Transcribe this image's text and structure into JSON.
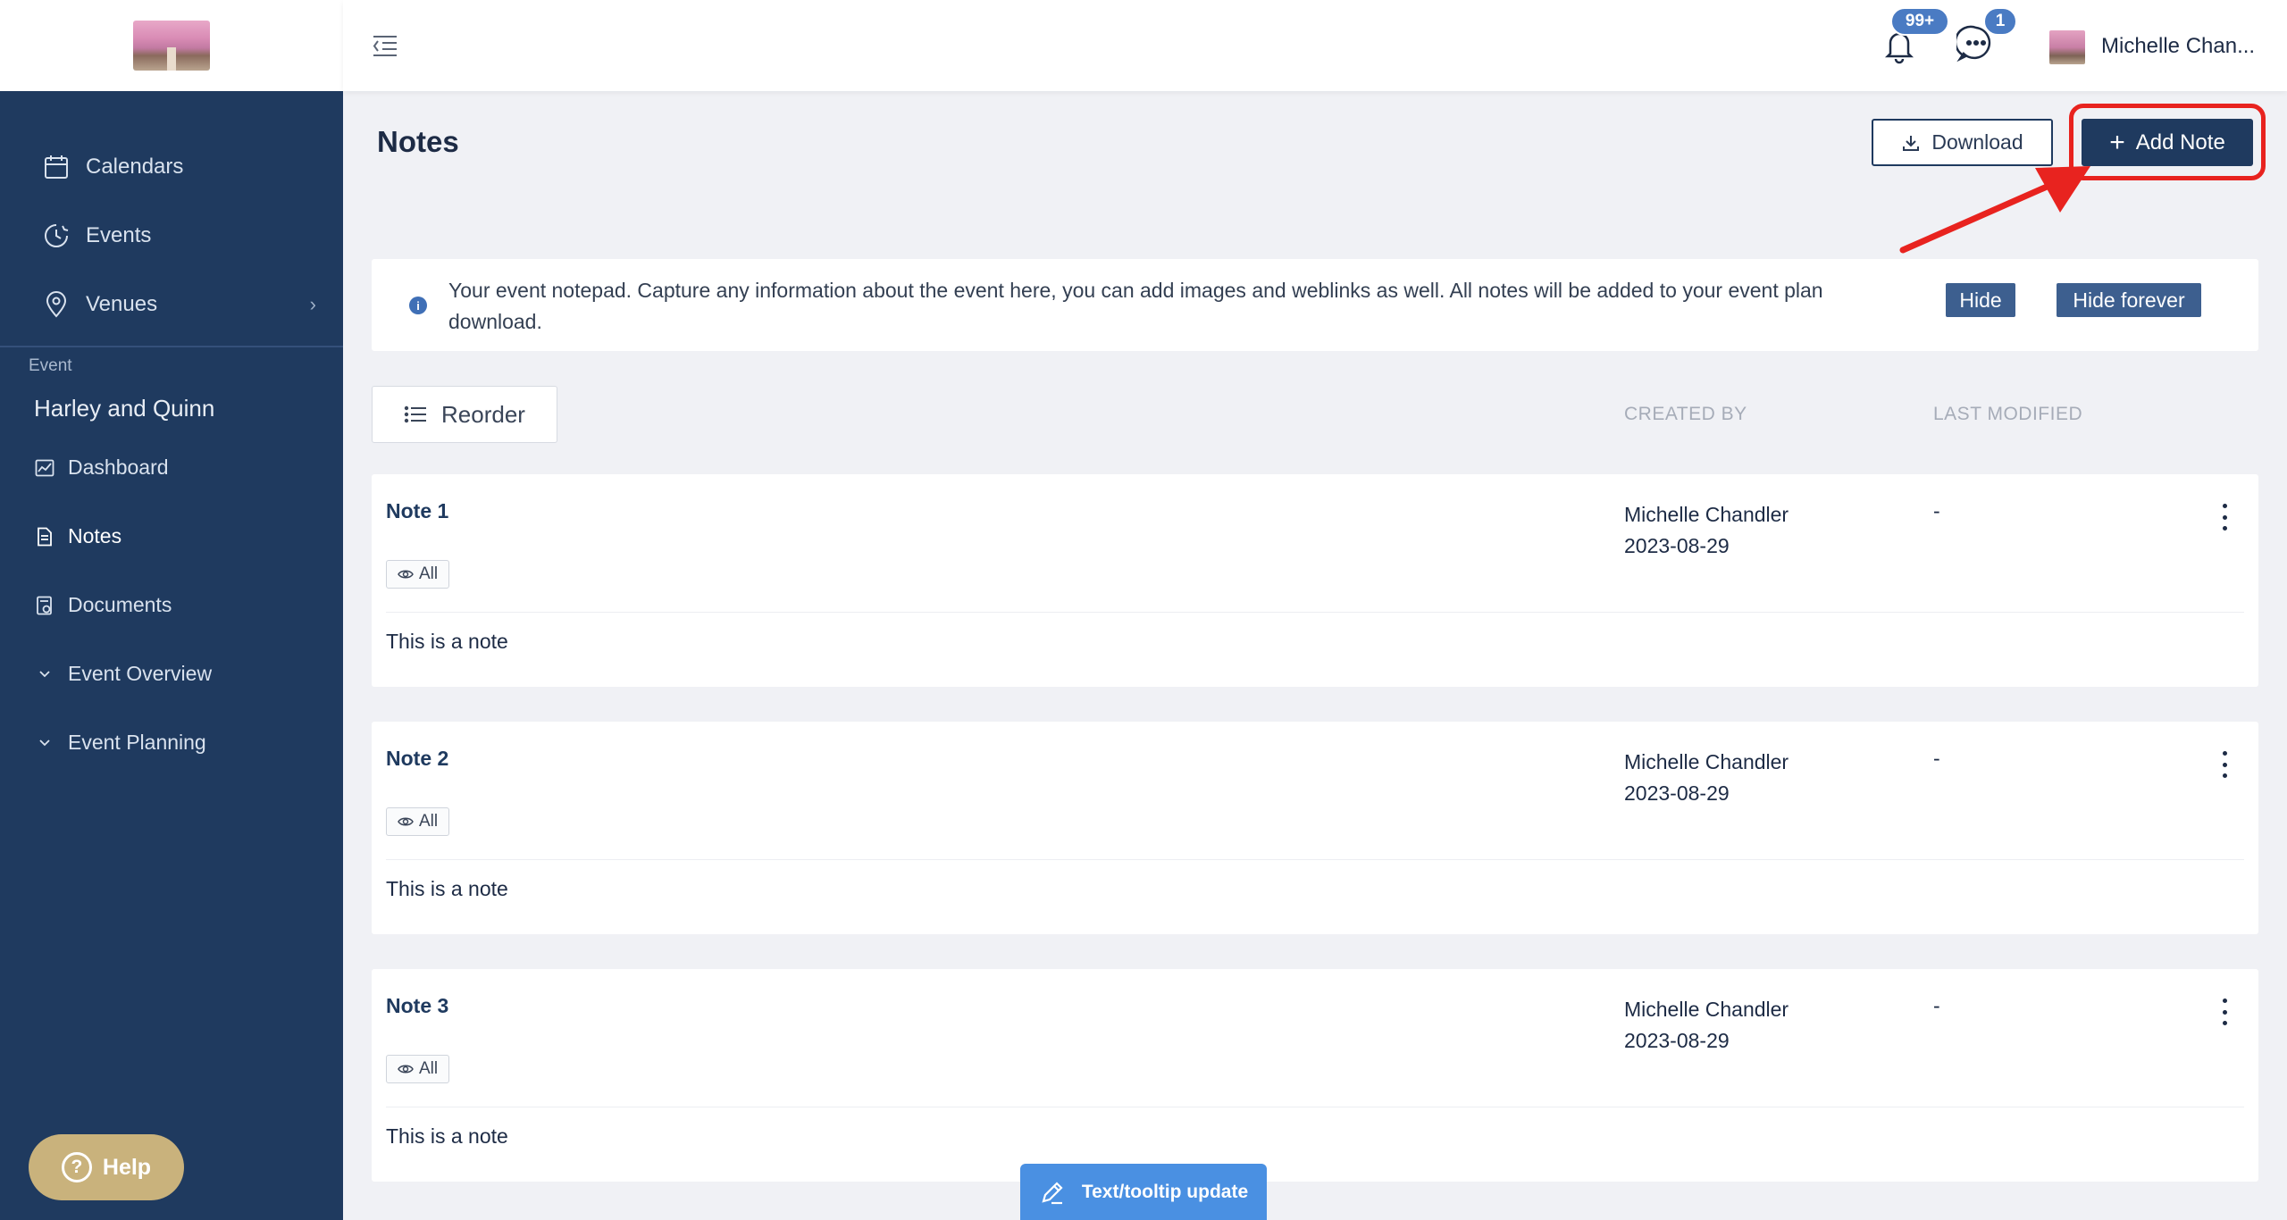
{
  "sidebar": {
    "nav": [
      {
        "label": "Calendars",
        "icon": "calendar-icon"
      },
      {
        "label": "Events",
        "icon": "clock-icon"
      },
      {
        "label": "Venues",
        "icon": "location-pin-icon"
      }
    ],
    "event_section_label": "Event",
    "event_name": "Harley and Quinn",
    "sub_nav": [
      {
        "label": "Dashboard",
        "icon": "chart-icon"
      },
      {
        "label": "Notes",
        "icon": "document-icon",
        "active": true
      },
      {
        "label": "Documents",
        "icon": "file-check-icon"
      },
      {
        "label": "Event Overview",
        "icon": "chevron-down-icon"
      },
      {
        "label": "Event Planning",
        "icon": "chevron-down-icon"
      }
    ],
    "help_label": "Help"
  },
  "topbar": {
    "notifications_count": "99+",
    "messages_count": "1",
    "user_name": "Michelle Chan..."
  },
  "page": {
    "title": "Notes",
    "download_label": "Download",
    "add_note_label": "Add Note"
  },
  "info": {
    "text": "Your event notepad. Capture any information about the event here, you can add images and weblinks as well. All notes will be added to your event plan download.",
    "hide_label": "Hide",
    "hide_forever_label": "Hide forever"
  },
  "list": {
    "reorder_label": "Reorder",
    "col_created_by": "CREATED BY",
    "col_last_modified": "LAST MODIFIED",
    "notes": [
      {
        "title": "Note 1",
        "visibility": "All",
        "body": "This is a note",
        "author": "Michelle Chandler",
        "created": "2023-08-29",
        "modified": "-"
      },
      {
        "title": "Note 2",
        "visibility": "All",
        "body": "This is a note",
        "author": "Michelle Chandler",
        "created": "2023-08-29",
        "modified": "-"
      },
      {
        "title": "Note 3",
        "visibility": "All",
        "body": "This is a note",
        "author": "Michelle Chandler",
        "created": "2023-08-29",
        "modified": "-"
      }
    ]
  },
  "tooltip_tab": {
    "label": "Text/tooltip update"
  },
  "colors": {
    "sidebar": "#1f3a5f",
    "primary_button": "#1f3a5f",
    "highlight": "#e8231f",
    "help": "#c9b27c",
    "tooltip_tab": "#4a90e2"
  }
}
